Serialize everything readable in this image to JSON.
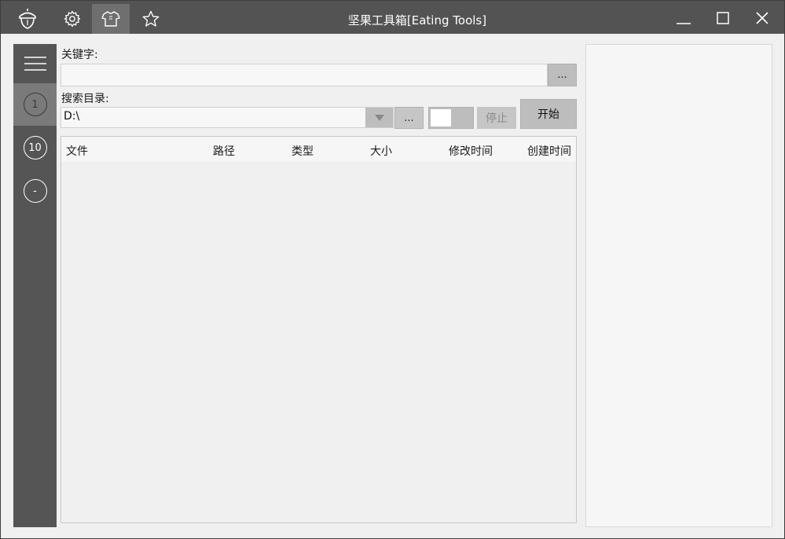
{
  "window": {
    "title": "坚果工具箱[Eating Tools]"
  },
  "titlebar": {
    "icons": [
      "acorn-icon",
      "gear-icon",
      "shirt-icon",
      "star-icon"
    ],
    "active_icon": "shirt-icon",
    "controls": [
      "minimize-icon",
      "maximize-icon",
      "close-icon"
    ]
  },
  "sidebar": {
    "menu_icon": "hamburger-icon",
    "items": [
      {
        "label": "1",
        "active": true
      },
      {
        "label": "10",
        "active": false
      },
      {
        "label": "-",
        "active": false
      }
    ]
  },
  "search": {
    "keyword_label": "关键字:",
    "keyword_value": "",
    "keyword_browse": "...",
    "dir_label": "搜索目录:",
    "dir_value": "D:\\",
    "dir_browse": "...",
    "stop_label": "停止",
    "start_label": "开始"
  },
  "table": {
    "columns": [
      "文件",
      "路径",
      "类型",
      "大小",
      "修改时间",
      "创建时间"
    ],
    "rows": []
  },
  "colors": {
    "titlebar": "#535353",
    "sidebar": "#555555",
    "sidebar_active": "#7a7a7a",
    "button": "#bdbdbd",
    "background": "#f0f0f0"
  }
}
